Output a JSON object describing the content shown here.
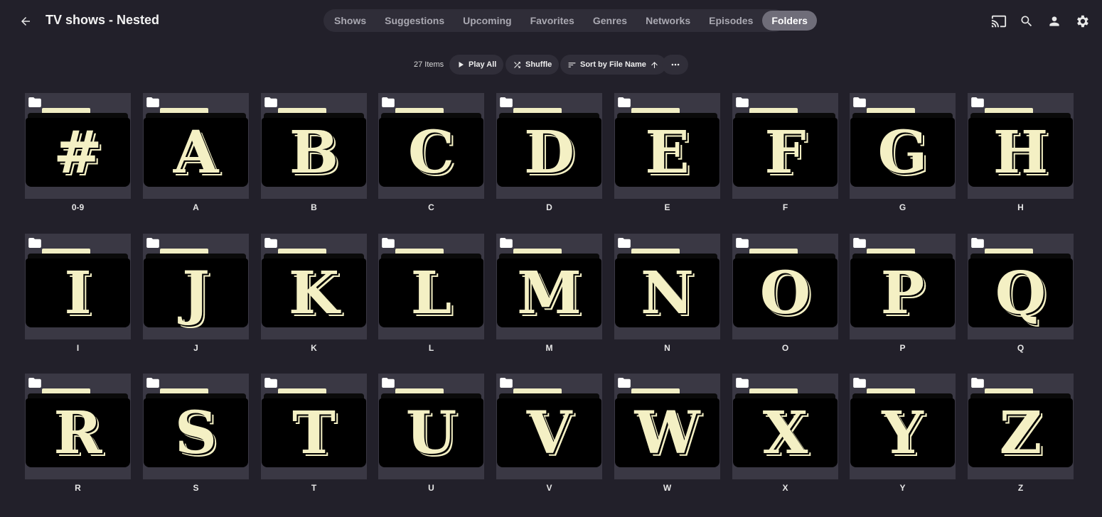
{
  "header": {
    "title": "TV shows - Nested",
    "tabs": [
      {
        "label": "Shows",
        "active": false
      },
      {
        "label": "Suggestions",
        "active": false
      },
      {
        "label": "Upcoming",
        "active": false
      },
      {
        "label": "Favorites",
        "active": false
      },
      {
        "label": "Genres",
        "active": false
      },
      {
        "label": "Networks",
        "active": false
      },
      {
        "label": "Episodes",
        "active": false
      },
      {
        "label": "Folders",
        "active": true
      }
    ],
    "icons": [
      "cast-icon",
      "search-icon",
      "user-icon",
      "settings-icon"
    ]
  },
  "toolbar": {
    "item_count": "27 Items",
    "play_all": "Play All",
    "shuffle": "Shuffle",
    "sort": "Sort by File Name",
    "more": "more-horizontal-icon"
  },
  "folders": [
    {
      "label": "0-9",
      "glyph": "#"
    },
    {
      "label": "A",
      "glyph": "A"
    },
    {
      "label": "B",
      "glyph": "B"
    },
    {
      "label": "C",
      "glyph": "C"
    },
    {
      "label": "D",
      "glyph": "D"
    },
    {
      "label": "E",
      "glyph": "E"
    },
    {
      "label": "F",
      "glyph": "F"
    },
    {
      "label": "G",
      "glyph": "G"
    },
    {
      "label": "H",
      "glyph": "H"
    },
    {
      "label": "I",
      "glyph": "I"
    },
    {
      "label": "J",
      "glyph": "J"
    },
    {
      "label": "K",
      "glyph": "K"
    },
    {
      "label": "L",
      "glyph": "L"
    },
    {
      "label": "M",
      "glyph": "M"
    },
    {
      "label": "N",
      "glyph": "N"
    },
    {
      "label": "O",
      "glyph": "O"
    },
    {
      "label": "P",
      "glyph": "P"
    },
    {
      "label": "Q",
      "glyph": "Q"
    },
    {
      "label": "R",
      "glyph": "R"
    },
    {
      "label": "S",
      "glyph": "S"
    },
    {
      "label": "T",
      "glyph": "T"
    },
    {
      "label": "U",
      "glyph": "U"
    },
    {
      "label": "V",
      "glyph": "V"
    },
    {
      "label": "W",
      "glyph": "W"
    },
    {
      "label": "X",
      "glyph": "X"
    },
    {
      "label": "Y",
      "glyph": "Y"
    },
    {
      "label": "Z",
      "glyph": "Z"
    }
  ],
  "colors": {
    "background": "#22202a",
    "accent_cream": "#f4f0c4",
    "active_tab": "#6f6d79"
  }
}
